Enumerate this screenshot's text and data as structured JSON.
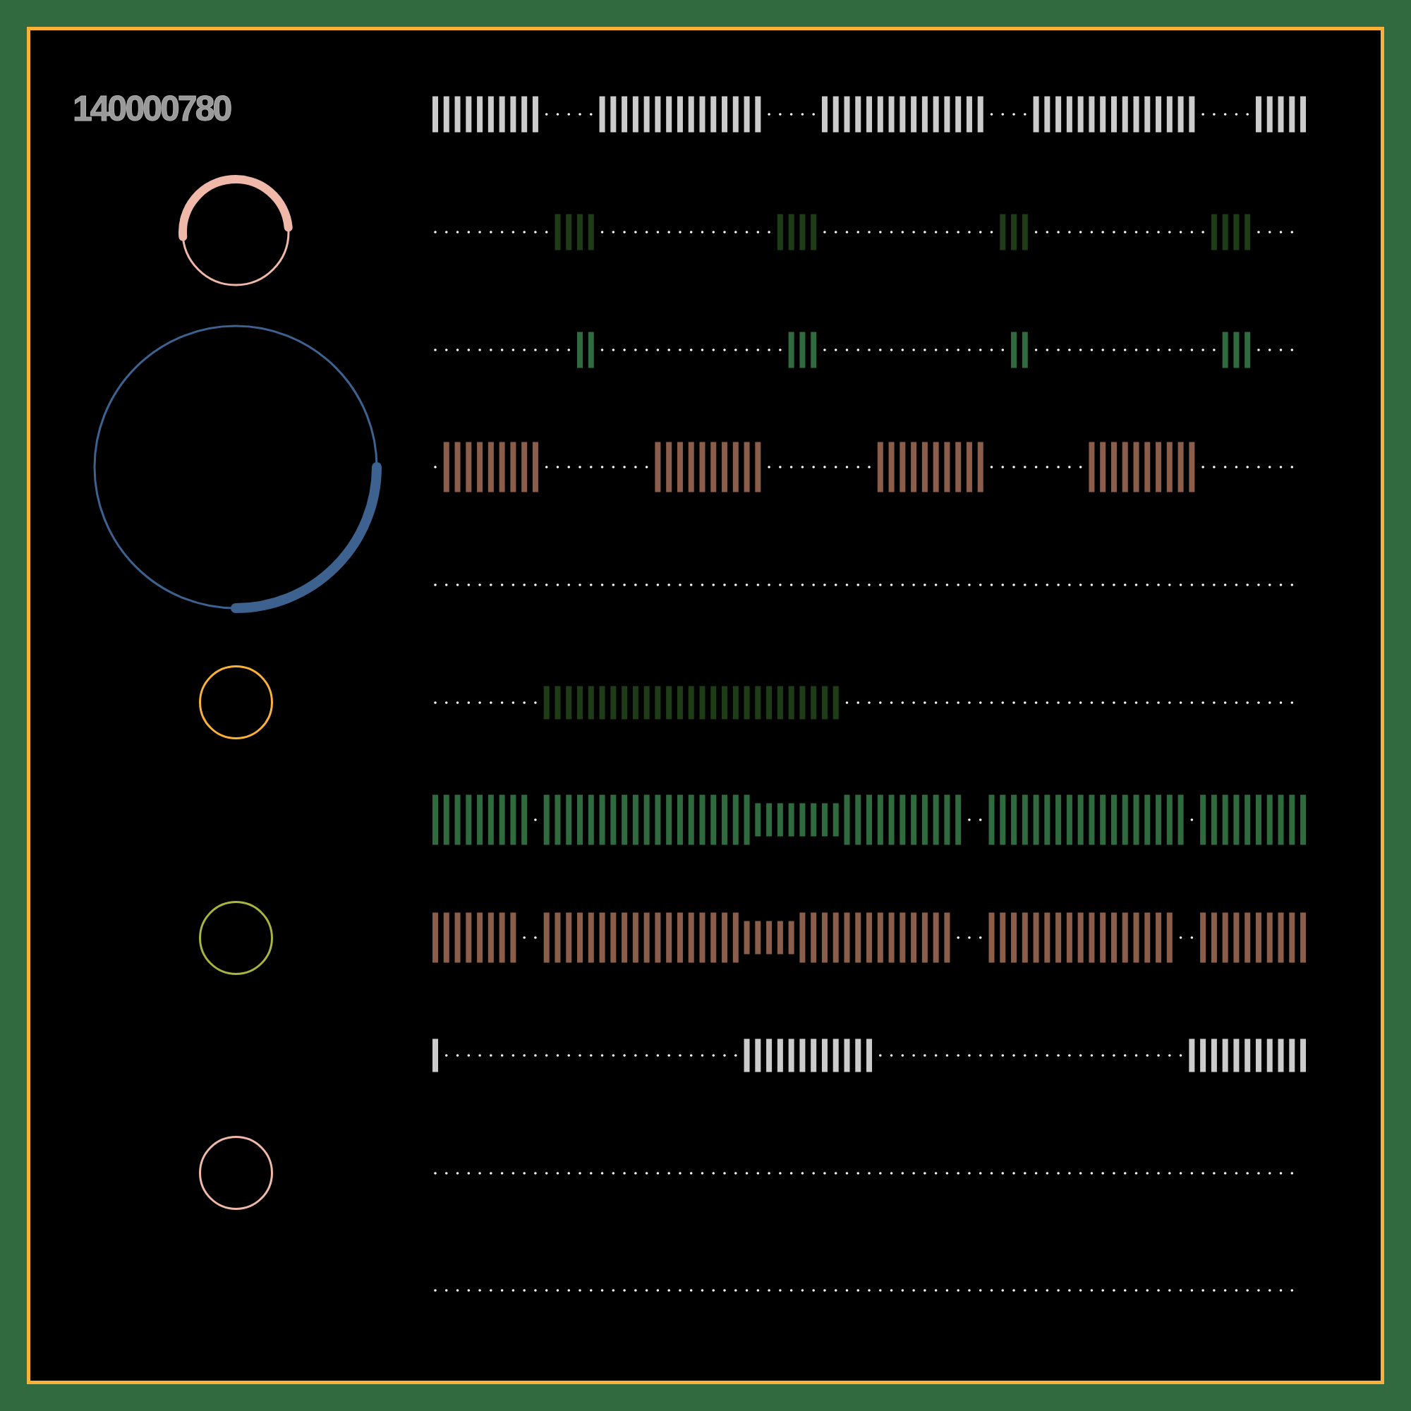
{
  "title": "140000780",
  "rings": [
    {
      "kind": "top-arc",
      "color": "#f0b8a8"
    },
    {
      "kind": "corner-arc",
      "color": "#3d6290"
    },
    {
      "kind": "plain",
      "color": "#fbb03b"
    },
    {
      "kind": "plain",
      "color": "#a9b43d"
    },
    {
      "kind": "plain",
      "color": "#f0b8a8"
    }
  ],
  "tracks": [
    {
      "kind": "bars",
      "color": "#cccccc"
    },
    {
      "kind": "bars",
      "color": "#1e3d17"
    },
    {
      "kind": "bars",
      "color": "#2f6b3f"
    },
    {
      "kind": "bars",
      "color": "#8a5e4b"
    },
    {
      "kind": "dots"
    },
    {
      "kind": "bars",
      "color": "#1e3d17"
    },
    {
      "kind": "bars",
      "color": "#2f6b3f"
    },
    {
      "kind": "bars",
      "color": "#8a5e4b"
    },
    {
      "kind": "bars",
      "color": "#cccccc"
    },
    {
      "kind": "dots"
    },
    {
      "kind": "dots"
    }
  ]
}
